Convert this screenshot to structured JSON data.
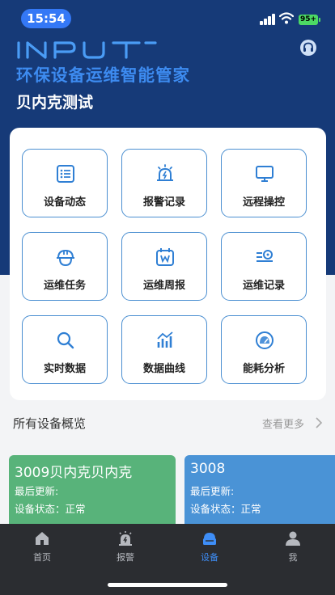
{
  "status_bar": {
    "time": "15:54",
    "battery": "95+"
  },
  "brand": {
    "logo_text": "INPUT",
    "subtitle": "环保设备运维智能管家",
    "accent_color": "#3d8bf0",
    "support_icon": "headset-icon"
  },
  "site": {
    "name": "贝内克测试"
  },
  "menu": [
    {
      "label": "设备动态",
      "icon": "list-icon"
    },
    {
      "label": "报警记录",
      "icon": "alarm-icon"
    },
    {
      "label": "远程操控",
      "icon": "monitor-icon"
    },
    {
      "label": "运维任务",
      "icon": "helmet-icon"
    },
    {
      "label": "运维周报",
      "icon": "calendar-icon"
    },
    {
      "label": "运维记录",
      "icon": "record-icon"
    },
    {
      "label": "实时数据",
      "icon": "search-icon"
    },
    {
      "label": "数据曲线",
      "icon": "chart-icon"
    },
    {
      "label": "能耗分析",
      "icon": "gauge-icon"
    }
  ],
  "overview": {
    "title": "所有设备概览",
    "more_label": "查看更多",
    "devices": [
      {
        "name": "3009贝内克贝内克",
        "last_update": "最后更新:",
        "status": "设备状态：正常",
        "color": "#58b37a"
      },
      {
        "name": "3008",
        "last_update": "最后更新:",
        "status": "设备状态：正常",
        "color": "#4a93d6"
      }
    ]
  },
  "tabs": [
    {
      "label": "首页",
      "icon": "home-icon",
      "active": false
    },
    {
      "label": "报警",
      "icon": "alarm-icon",
      "active": false
    },
    {
      "label": "设备",
      "icon": "device-icon",
      "active": true
    },
    {
      "label": "我",
      "icon": "user-icon",
      "active": false
    }
  ]
}
